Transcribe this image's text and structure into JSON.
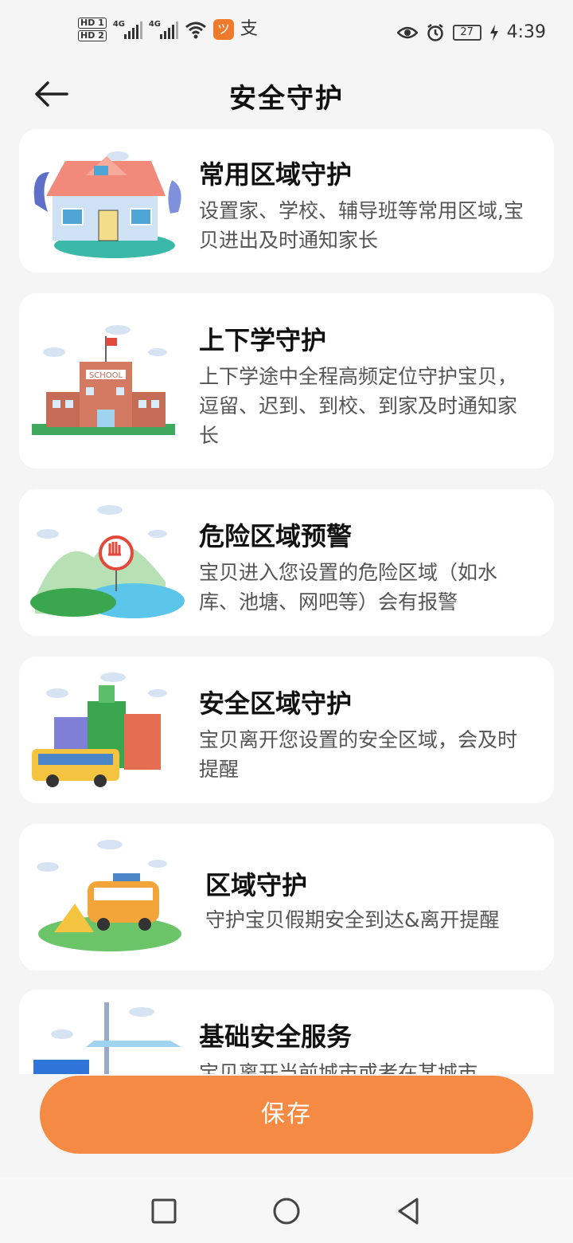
{
  "status_bar": {
    "hd1": "HD 1",
    "hd2": "HD 2",
    "net1": "4G",
    "net2": "4G",
    "app_icon": "ツ",
    "alipay_icon": "支",
    "battery": "27",
    "time": "4:39"
  },
  "header": {
    "title": "安全守护"
  },
  "cards": [
    {
      "title": "常用区域守护",
      "desc": "设置家、学校、辅导班等常用区域,宝贝进出及时通知家长"
    },
    {
      "title": "上下学守护",
      "desc": "上下学途中全程高频定位守护宝贝，逗留、迟到、到校、到家及时通知家长",
      "sign": "SCHOOL"
    },
    {
      "title": "危险区域预警",
      "desc": "宝贝进入您设置的危险区域（如水库、池塘、网吧等）会有报警"
    },
    {
      "title": "安全区域守护",
      "desc": "宝贝离开您设置的安全区域，会及时提醒"
    },
    {
      "title": "区域守护",
      "desc": "守护宝贝假期安全到达&离开提醒"
    },
    {
      "title": "基础安全服务",
      "desc": "宝贝离开当前城市或者在某城市"
    }
  ],
  "save_label": "保存",
  "colors": {
    "accent": "#f58a44",
    "card_bg": "#ffffff",
    "page_bg": "#f5f5f5"
  },
  "nav": {
    "icons": [
      "recent-apps-icon",
      "home-icon",
      "back-icon"
    ]
  }
}
